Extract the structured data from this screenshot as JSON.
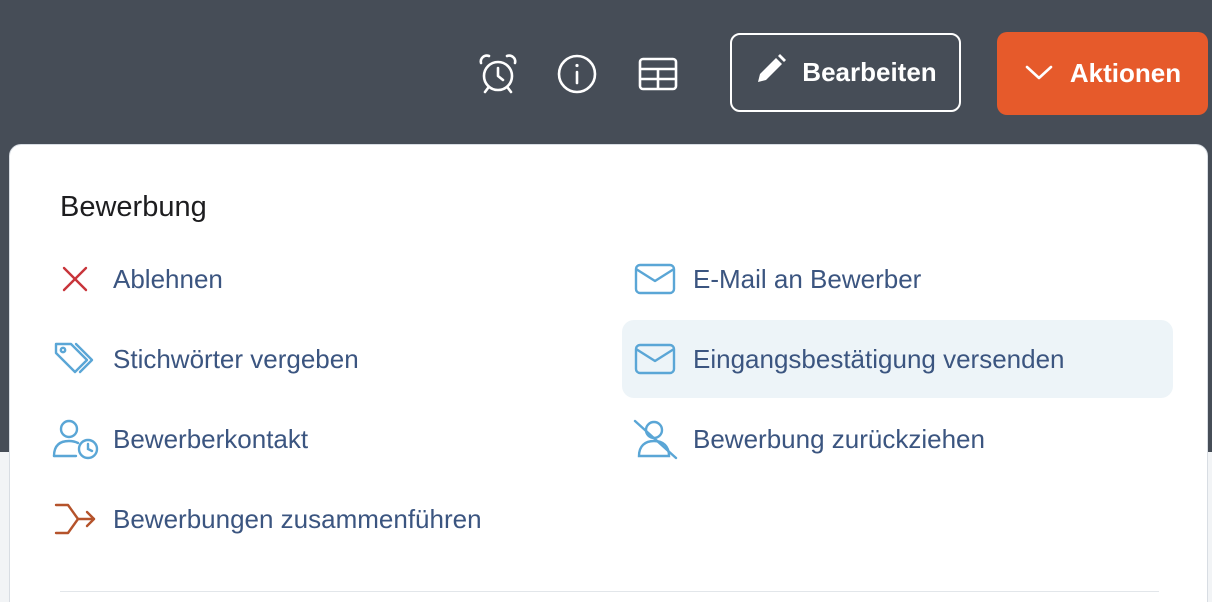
{
  "header": {
    "icons": {
      "alarm": "alarm-clock-icon",
      "info": "info-icon",
      "table": "table-icon"
    },
    "edit_button": {
      "label": "Bearbeiten",
      "icon": "pencil-icon"
    },
    "actions_button": {
      "label": "Aktionen",
      "icon": "chevron-down-icon"
    }
  },
  "menu": {
    "section_title": "Bewerbung",
    "left_items": [
      {
        "label": "Ablehnen",
        "icon": "close-icon"
      },
      {
        "label": "Stichwörter vergeben",
        "icon": "tags-icon"
      },
      {
        "label": "Bewerberkontakt",
        "icon": "user-clock-icon"
      },
      {
        "label": "Bewerbungen zusammenführen",
        "icon": "merge-arrow-icon"
      }
    ],
    "right_items": [
      {
        "label": "E-Mail an Bewerber",
        "icon": "envelope-icon"
      },
      {
        "label": "Eingangsbestätigung versenden",
        "icon": "envelope-icon",
        "highlighted": true
      },
      {
        "label": "Bewerbung zurückziehen",
        "icon": "user-slash-icon"
      }
    ]
  },
  "colors": {
    "header_bg": "#464d57",
    "accent": "#e65a2b",
    "link": "#3b5580",
    "icon_blue": "#5aa6d6",
    "danger": "#c8343a",
    "merge": "#b5532b",
    "highlight": "#edf4f8"
  }
}
